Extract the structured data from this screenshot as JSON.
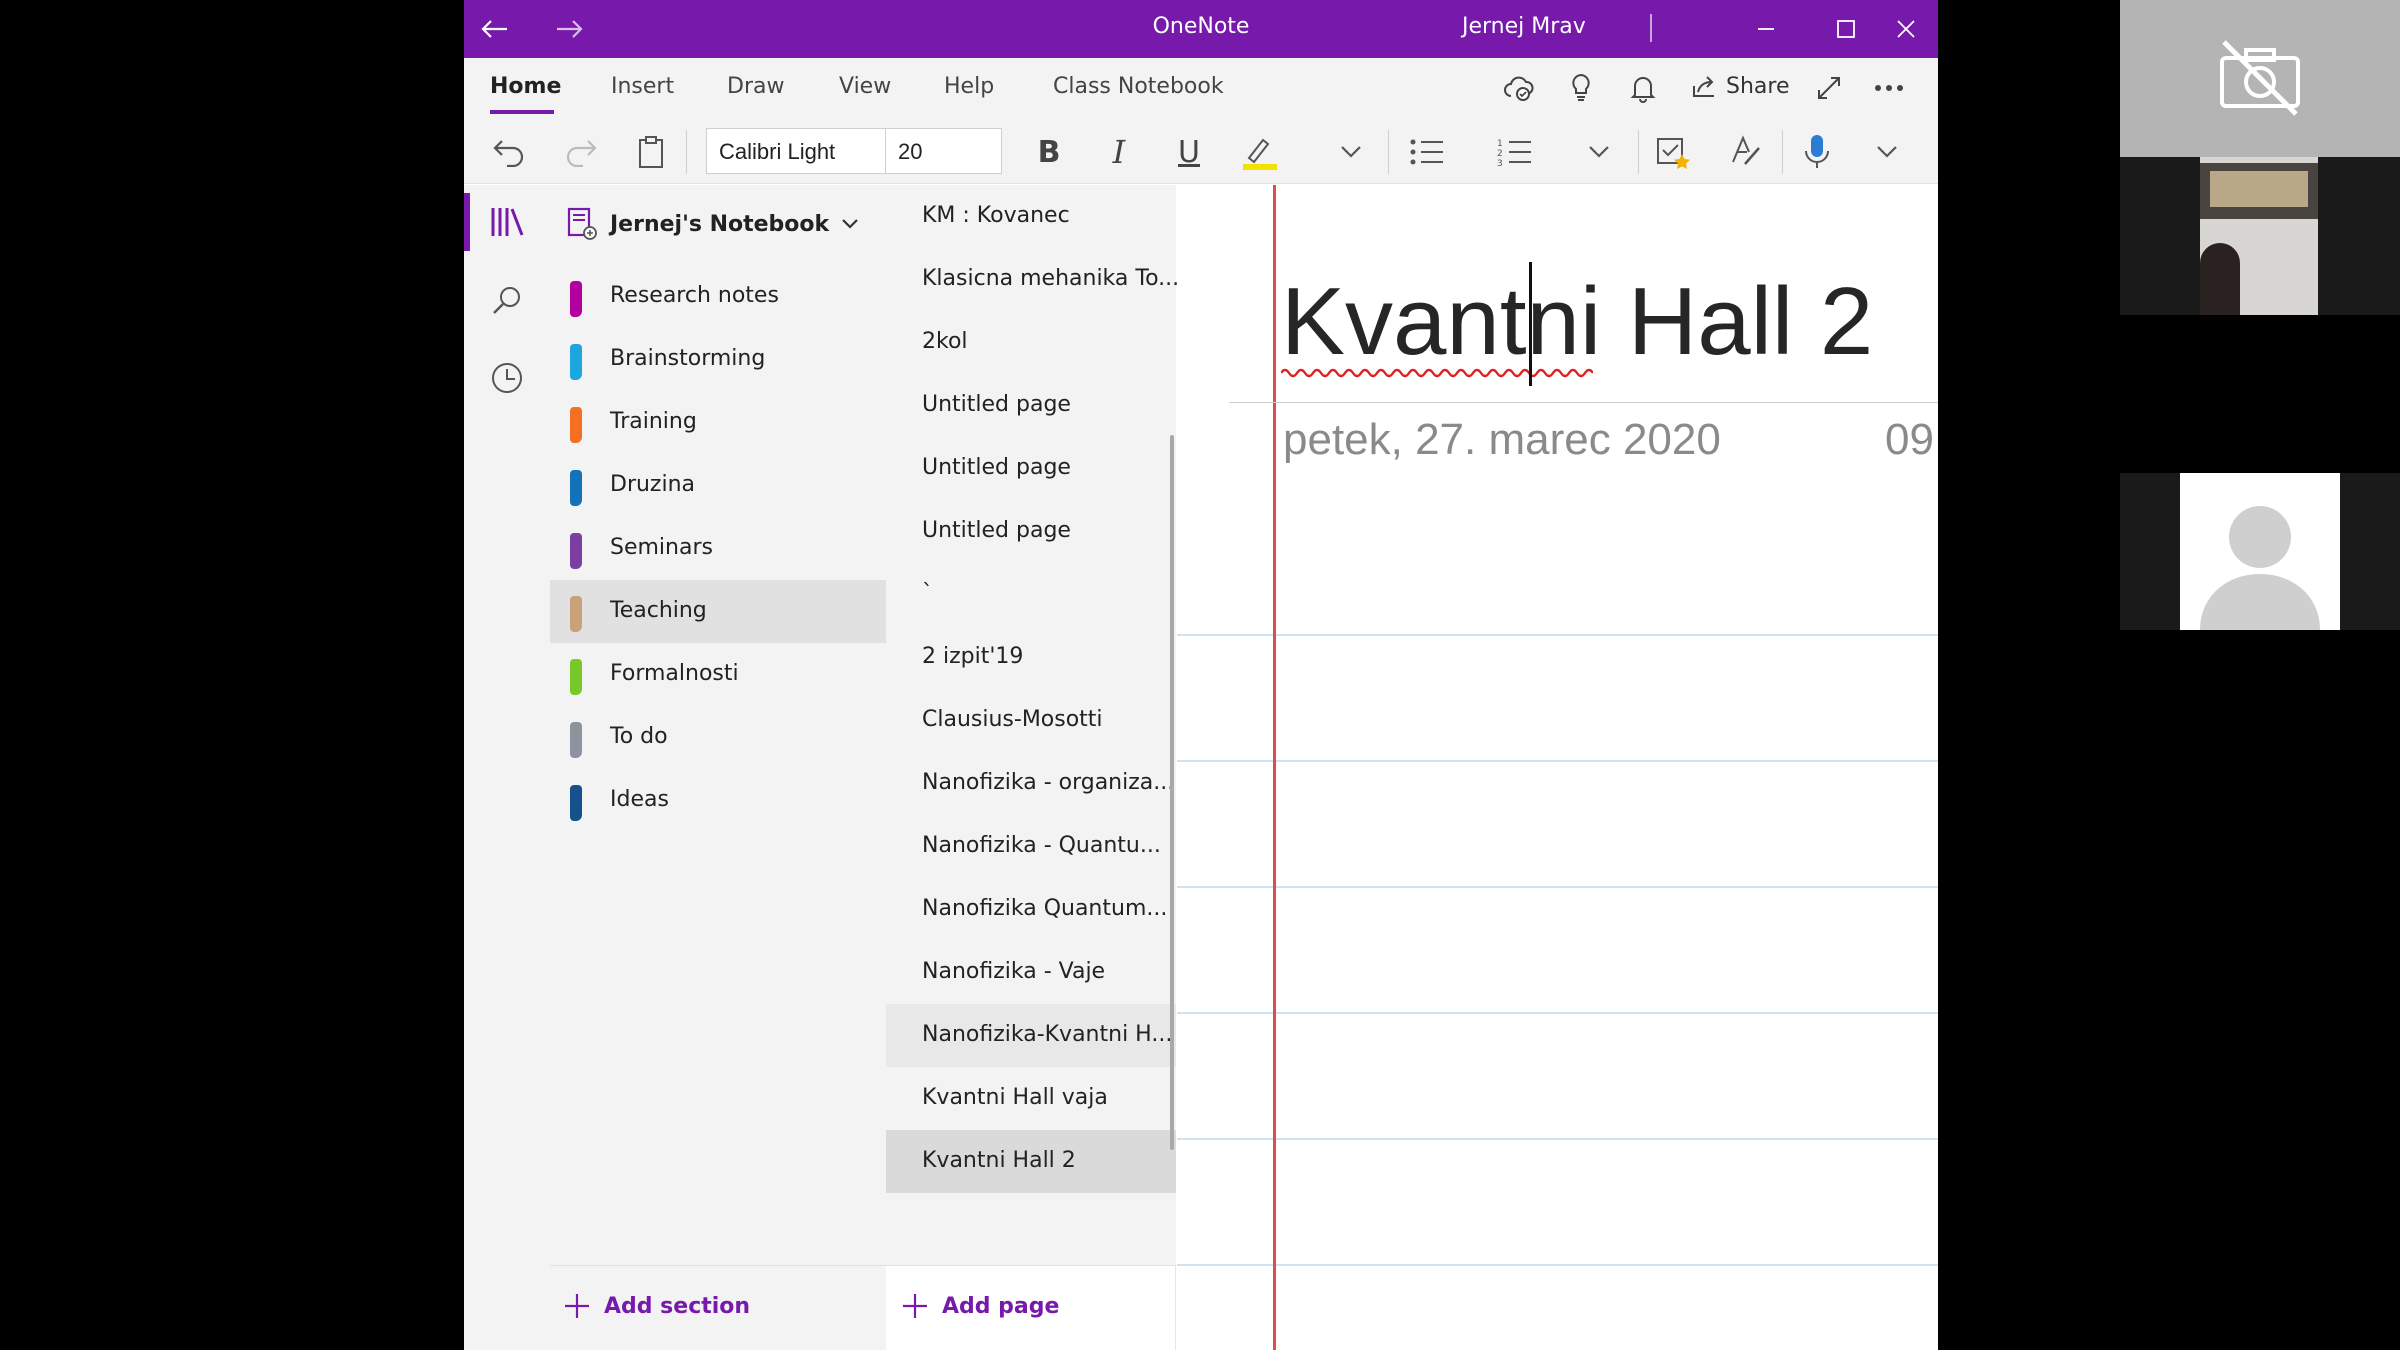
{
  "window": {
    "title": "OneNote",
    "user": "Jernej Mrav"
  },
  "tabs": [
    {
      "label": "Home"
    },
    {
      "label": "Insert"
    },
    {
      "label": "Draw"
    },
    {
      "label": "View"
    },
    {
      "label": "Help"
    },
    {
      "label": "Class Notebook"
    }
  ],
  "ribbon_right": {
    "share_label": "Share"
  },
  "toolbar": {
    "font_name": "Calibri Light",
    "font_size": "20",
    "highlight_color": "#f2e200"
  },
  "notebook": {
    "name": "Jernej's Notebook"
  },
  "sections": [
    {
      "label": "Research notes",
      "color": "#b4009e"
    },
    {
      "label": "Brainstorming",
      "color": "#1da6e0"
    },
    {
      "label": "Training",
      "color": "#f46f21"
    },
    {
      "label": "Druzina",
      "color": "#1373b8"
    },
    {
      "label": "Seminars",
      "color": "#7b3fa0"
    },
    {
      "label": "Teaching",
      "color": "#c8a27a",
      "selected": true
    },
    {
      "label": "Formalnosti",
      "color": "#78c82a"
    },
    {
      "label": "To do",
      "color": "#8c959e"
    },
    {
      "label": "Ideas",
      "color": "#16508d"
    }
  ],
  "add_section_label": "Add section",
  "pages": [
    {
      "label": "KM : Kovanec"
    },
    {
      "label": "Klasicna mehanika To..."
    },
    {
      "label": "2kol"
    },
    {
      "label": "Untitled page"
    },
    {
      "label": "Untitled page"
    },
    {
      "label": "Untitled page"
    },
    {
      "label": "`"
    },
    {
      "label": "2 izpit'19"
    },
    {
      "label": "Clausius-Mosotti"
    },
    {
      "label": "Nanofizika - organiza..."
    },
    {
      "label": "Nanofizika - Quantu..."
    },
    {
      "label": "Nanofizika Quantum..."
    },
    {
      "label": "Nanofizika - Vaje"
    },
    {
      "label": "Nanofizika-Kvantni H..."
    },
    {
      "label": "Kvantni Hall vaja"
    },
    {
      "label": "Kvantni Hall 2",
      "selected": true
    }
  ],
  "add_page_label": "Add page",
  "page": {
    "title": "Kvantni Hall 2",
    "date": "petek, 27. marec 2020",
    "time": "09:"
  },
  "colors": {
    "accent": "#7719aa",
    "margin_line": "#e24b4b",
    "rule_line": "#cfe3f2"
  }
}
